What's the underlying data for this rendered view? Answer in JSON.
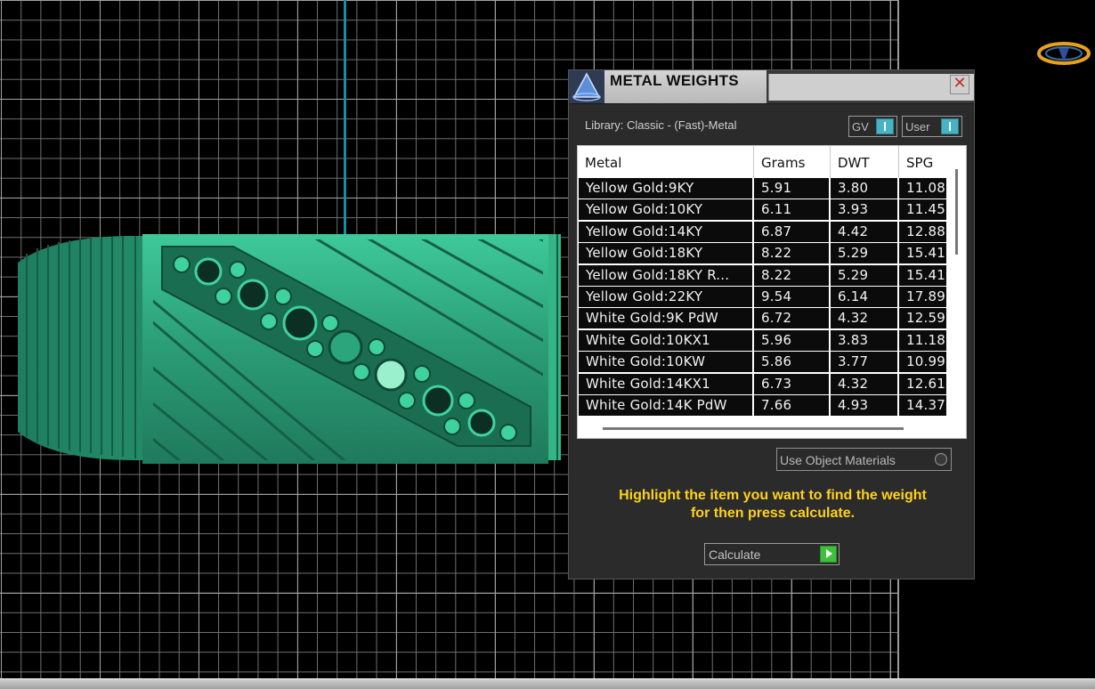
{
  "panel": {
    "title": "METAL WEIGHTS",
    "close_symbol": "✕",
    "library_label": "Library: Classic - (Fast)-Metal",
    "toggles": {
      "gv": "GV",
      "user": "User"
    },
    "table": {
      "columns": [
        "Metal",
        "Grams",
        "DWT",
        "SPG"
      ],
      "rows": [
        [
          "Yellow Gold:9KY",
          "5.91",
          "3.80",
          "11.08"
        ],
        [
          "Yellow Gold:10KY",
          "6.11",
          "3.93",
          "11.45"
        ],
        [
          "Yellow Gold:14KY",
          "6.87",
          "4.42",
          "12.88"
        ],
        [
          "Yellow Gold:18KY",
          "8.22",
          "5.29",
          "15.41"
        ],
        [
          "Yellow Gold:18KY R...",
          "8.22",
          "5.29",
          "15.41"
        ],
        [
          "Yellow Gold:22KY",
          "9.54",
          "6.14",
          "17.89"
        ],
        [
          "White Gold:9K PdW",
          "6.72",
          "4.32",
          "12.59"
        ],
        [
          "White Gold:10KX1",
          "5.96",
          "3.83",
          "11.18"
        ],
        [
          "White Gold:10KW",
          "5.86",
          "3.77",
          "10.99"
        ],
        [
          "White Gold:14KX1",
          "6.73",
          "4.32",
          "12.61"
        ],
        [
          "White Gold:14K PdW",
          "7.66",
          "4.93",
          "14.37"
        ]
      ]
    },
    "use_object_materials": "Use Object Materials",
    "hint_line1": "Highlight the item you want to find the weight",
    "hint_line2": "for then press calculate.",
    "calculate_label": "Calculate"
  },
  "colors": {
    "ring": "#2fa57e",
    "hint": "#ffd21a",
    "accent": "#49b3c6",
    "play": "#3fbf3a"
  },
  "icons": {
    "panel_icon": "pyramid-icon",
    "viewport_icon": "view-compass-icon"
  }
}
